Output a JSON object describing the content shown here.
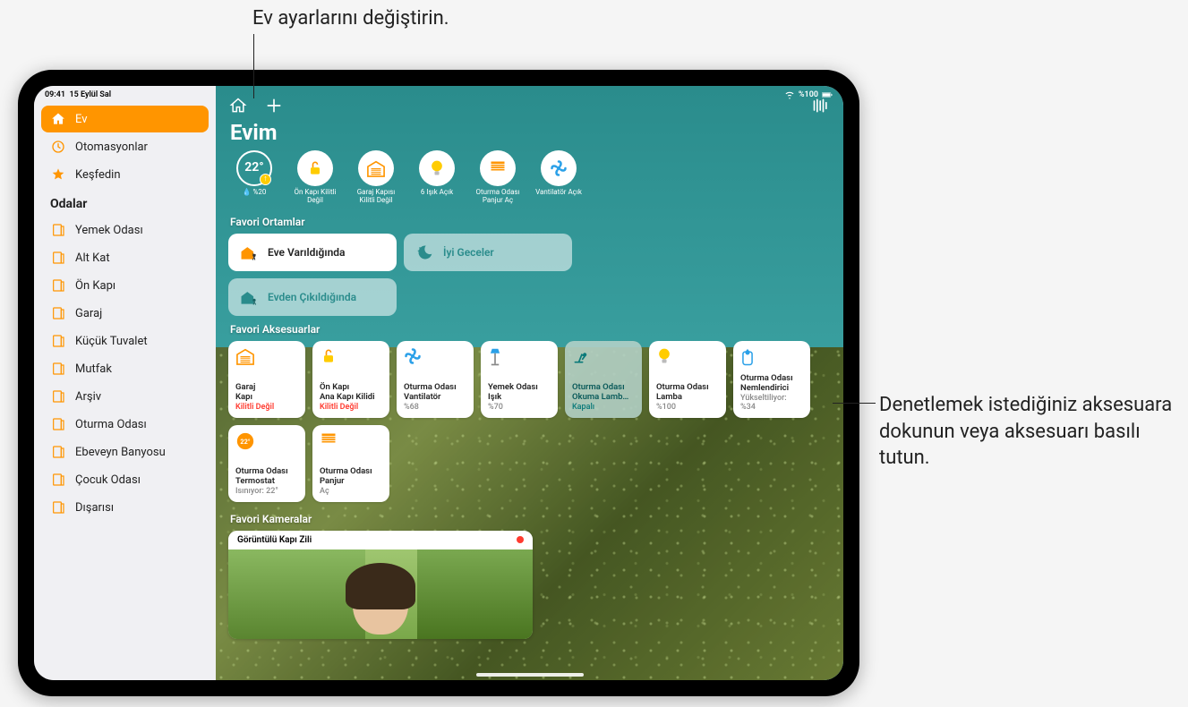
{
  "callouts": {
    "top": "Ev ayarlarını değiştirin.",
    "right": "Denetlemek istediğiniz aksesuara dokunun veya aksesuarı basılı tutun."
  },
  "statusbar": {
    "time": "09:41",
    "date": "15 Eylül Sal",
    "battery": "%100"
  },
  "sidebar": {
    "main": [
      {
        "label": "Ev",
        "icon": "home",
        "active": true
      },
      {
        "label": "Otomasyonlar",
        "icon": "clock",
        "active": false
      },
      {
        "label": "Keşfedin",
        "icon": "star",
        "active": false
      }
    ],
    "rooms_header": "Odalar",
    "rooms": [
      {
        "label": "Yemek Odası"
      },
      {
        "label": "Alt Kat"
      },
      {
        "label": "Ön Kapı"
      },
      {
        "label": "Garaj"
      },
      {
        "label": "Küçük Tuvalet"
      },
      {
        "label": "Mutfak"
      },
      {
        "label": "Arşiv"
      },
      {
        "label": "Oturma Odası"
      },
      {
        "label": "Ebeveyn Banyosu"
      },
      {
        "label": "Çocuk Odası"
      },
      {
        "label": "Dışarısı"
      }
    ]
  },
  "home": {
    "title": "Evim",
    "weather": {
      "temp": "22°",
      "humidity": "%20"
    },
    "status_chips": [
      {
        "label": "Ön Kapı Kilitli Değil",
        "icon": "lock-open"
      },
      {
        "label": "Garaj Kapısı Kilitli Değil",
        "icon": "garage"
      },
      {
        "label": "6 Işık Açık",
        "icon": "bulb"
      },
      {
        "label": "Oturma Odası Panjur Aç",
        "icon": "blinds"
      },
      {
        "label": "Vantilatör Açık",
        "icon": "fan"
      }
    ],
    "scenes_header": "Favori Ortamlar",
    "scenes": [
      {
        "label": "Eve Varıldığında",
        "icon": "arrive",
        "active": true
      },
      {
        "label": "İyi Geceler",
        "icon": "moon",
        "active": false
      },
      {
        "label": "Evden Çıkıldığında",
        "icon": "leave",
        "active": false
      }
    ],
    "acc_header": "Favori Aksesuarlar",
    "accessories": [
      {
        "name": "Garaj\nKapı",
        "status": "Kilitli Değil",
        "status_class": "red",
        "icon": "garage"
      },
      {
        "name": "Ön Kapı\nAna Kapı Kilidi",
        "status": "Kilitli Değil",
        "status_class": "red",
        "icon": "lock-open"
      },
      {
        "name": "Oturma Odası\nVantilatör",
        "status": "%68",
        "icon": "fan"
      },
      {
        "name": "Yemek Odası\nIşık",
        "status": "%70",
        "icon": "lamp-floor"
      },
      {
        "name": "Oturma Odası\nOkuma Lamb…",
        "status": "Kapalı",
        "icon": "lamp-desk",
        "dim": true
      },
      {
        "name": "Oturma Odası\nLamba",
        "status": "%100",
        "icon": "bulb"
      },
      {
        "name": "Oturma Odası\nNemlendirici",
        "status": "Yükseltiliyor: %34",
        "icon": "humidifier"
      }
    ],
    "accessories2": [
      {
        "name": "Oturma Odası\nTermostat",
        "status": "Isınıyor: 22°",
        "icon": "thermostat"
      },
      {
        "name": "Oturma Odası\nPanjur",
        "status": "Aç",
        "icon": "blinds"
      }
    ],
    "cam_header": "Favori Kameralar",
    "camera": {
      "label": "Görüntülü Kapı Zili"
    }
  },
  "colors": {
    "accent": "#ff9500",
    "teal": "#2a8c8c",
    "red": "#ff3b30",
    "yellow": "#ffcc00",
    "blue": "#2aa0e8"
  }
}
